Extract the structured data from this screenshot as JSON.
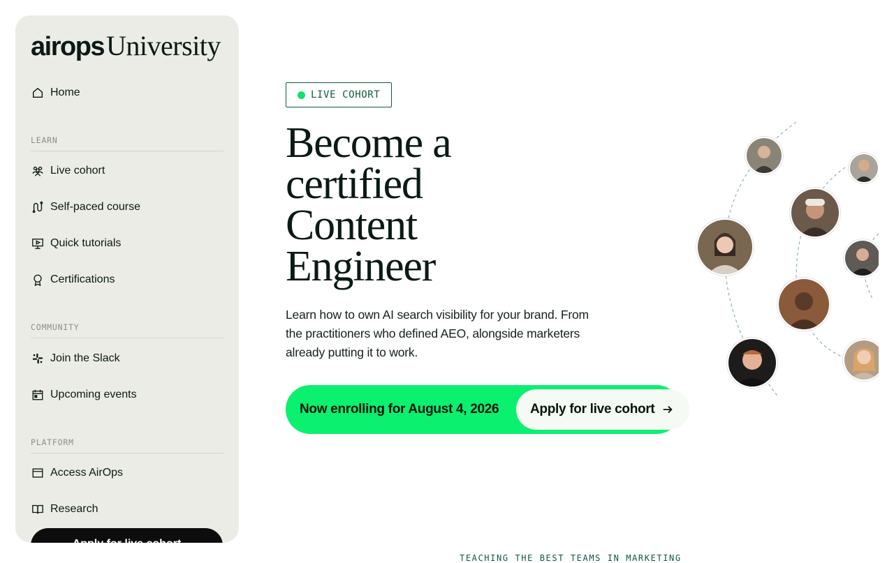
{
  "brand": {
    "logo_primary": "airops",
    "logo_secondary": "University"
  },
  "nav": {
    "home": "Home",
    "sections": [
      {
        "label": "LEARN",
        "items": [
          "Live cohort",
          "Self-paced course",
          "Quick tutorials",
          "Certifications"
        ]
      },
      {
        "label": "COMMUNITY",
        "items": [
          "Join the Slack",
          "Upcoming events"
        ]
      },
      {
        "label": "PLATFORM",
        "items": [
          "Access AirOps",
          "Research"
        ]
      }
    ],
    "cta": "Apply for live cohort"
  },
  "hero": {
    "badge": "LIVE COHORT",
    "title_lines": [
      "Become a",
      "certified",
      "Content",
      "Engineer"
    ],
    "description": "Learn how to own AI search visibility for your brand. From the practitioners who defined AEO, alongside marketers already putting it to work.",
    "enroll_text": "Now enrolling for August 4, 2026",
    "apply_button": "Apply for live cohort"
  },
  "caption": "TEACHING THE BEST TEAMS IN MARKETING",
  "colors": {
    "accent": "#0bf06f",
    "sidebar_bg": "#ecece6",
    "badge_border": "#0f5a3a",
    "dark_button": "#0d0d0d"
  },
  "icons": {
    "home": "home-icon",
    "live_cohort": "people-icon",
    "self_paced": "route-icon",
    "tutorials": "screen-play-icon",
    "certifications": "badge-ribbon-icon",
    "slack": "slack-icon",
    "events": "calendar-icon",
    "access": "window-icon",
    "research": "book-icon"
  }
}
